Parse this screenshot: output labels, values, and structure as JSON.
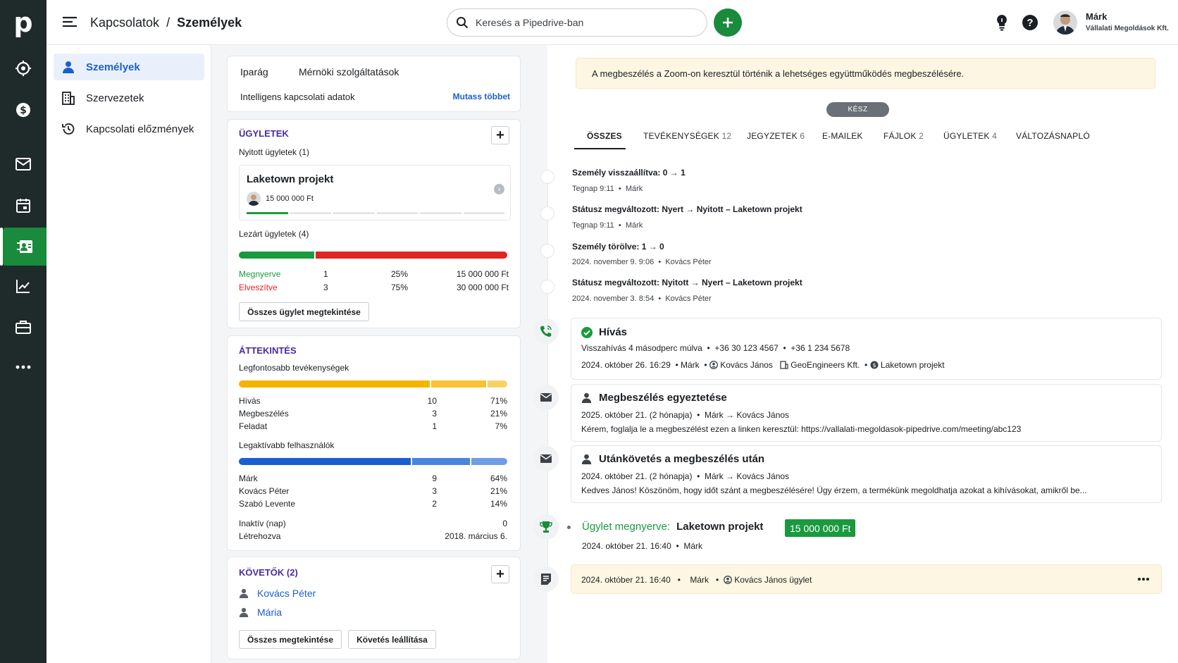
{
  "app": {
    "logo": "p"
  },
  "topbar": {
    "breadcrumb_parent": "Kapcsolatok",
    "breadcrumb_sep": "/",
    "breadcrumb_current": "Személyek",
    "search_placeholder": "Keresés a Pipedrive-ban",
    "user_name": "Márk",
    "user_company": "Vállalati Megoldások Kft."
  },
  "subnav": {
    "items": [
      {
        "label": "Személyek"
      },
      {
        "label": "Szervezetek"
      },
      {
        "label": "Kapcsolati előzmények"
      }
    ]
  },
  "info": {
    "industry_label": "Iparág",
    "industry_value": "Mérnöki szolgáltatások",
    "smart_label": "Intelligens kapcsolati adatok",
    "show_more": "Mutass többet"
  },
  "deals": {
    "title": "ÜGYLETEK",
    "open_label": "Nyitott ügyletek (1)",
    "deal_name": "Laketown projekt",
    "deal_value": "15 000 000 Ft",
    "closed_label": "Lezárt ügyletek (4)",
    "won_fraction": 0.28,
    "stats": [
      {
        "label": "Megnyerve",
        "count": "1",
        "pct": "25%",
        "amount": "15 000 000 Ft",
        "color": "#1a9a3e"
      },
      {
        "label": "Elveszítve",
        "count": "3",
        "pct": "75%",
        "amount": "30 000 000 Ft",
        "color": "#e02424"
      }
    ],
    "view_all": "Összes ügylet megtekintése"
  },
  "overview": {
    "title": "ÁTTEKINTÉS",
    "top_label": "Legfontosabb tevékenységek",
    "activities": [
      {
        "label": "Hívás",
        "count": "10",
        "pct": "71%",
        "share": 0.71
      },
      {
        "label": "Megbeszélés",
        "count": "3",
        "pct": "21%",
        "share": 0.21
      },
      {
        "label": "Feladat",
        "count": "1",
        "pct": "7%",
        "share": 0.08
      }
    ],
    "users_label": "Legaktívabb felhasználók",
    "users": [
      {
        "label": "Márk",
        "count": "9",
        "pct": "64%",
        "share": 0.64
      },
      {
        "label": "Kovács Péter",
        "count": "3",
        "pct": "21%",
        "share": 0.22
      },
      {
        "label": "Szabó Levente",
        "count": "2",
        "pct": "14%",
        "share": 0.14
      }
    ],
    "inactive_label": "Inaktív (nap)",
    "inactive_value": "0",
    "created_label": "Létrehozva",
    "created_value": "2018. március 6."
  },
  "followers": {
    "title": "KÖVETŐK (2)",
    "items": [
      {
        "name": "Kovács Péter"
      },
      {
        "name": "Mária"
      }
    ],
    "view_all": "Összes megtekintése",
    "stop": "Követés leállítása"
  },
  "banner": {
    "text": "A megbeszélés a Zoom-on keresztül történik a lehetséges együttműködés megbeszélésére.",
    "done": "KÉSZ"
  },
  "tabs": [
    {
      "label": "ÖSSZES",
      "count": ""
    },
    {
      "label": "TEVÉKENYSÉGEK",
      "count": "12"
    },
    {
      "label": "JEGYZETEK",
      "count": "6"
    },
    {
      "label": "E-MAILEK",
      "count": ""
    },
    {
      "label": "FÁJLOK",
      "count": "2"
    },
    {
      "label": "ÜGYLETEK",
      "count": "4"
    },
    {
      "label": "VÁLTOZÁSNAPLÓ",
      "count": ""
    }
  ],
  "changes": [
    {
      "title": "Személy visszaállítva: 0 → 1",
      "meta": "Tegnap 9:11",
      "user": "Márk"
    },
    {
      "title": "Státusz megváltozott: Nyert → Nyitott – Laketown projekt",
      "meta": "Tegnap 9:11",
      "user": "Márk"
    },
    {
      "title": "Személy törölve: 1 → 0",
      "meta": "2024. november 9. 9:06",
      "user": "Kovács Péter"
    },
    {
      "title": "Státusz megváltozott: Nyitott → Nyert – Laketown projekt",
      "meta": "2024. november 3. 8:54",
      "user": "Kovács Péter"
    }
  ],
  "call": {
    "title": "Hívás",
    "line1a": "Visszahívás 4 másodperc múlva",
    "phone1": "+36 30 123 4567",
    "phone2": "+36 1 234 5678",
    "date": "2024. október 26. 16:29",
    "user": "Márk",
    "person": "Kovács János",
    "org": "GeoEngineers Kft.",
    "deal": "Laketown projekt"
  },
  "email1": {
    "title": "Megbeszélés egyeztetése",
    "date": "2025. október 21. (2 hónapja)",
    "from": "Márk",
    "to": "Kovács János",
    "body": "Kérem, foglalja le a megbeszélést ezen a linken keresztül: https://vallalati-megoldasok-pipedrive.com/meeting/abc123"
  },
  "email2": {
    "title": "Utánkövetés a megbeszélés után",
    "date": "2024. október 21. (2 hónapja)",
    "from": "Márk",
    "to": "Kovács János",
    "body": "Kedves János! Köszönöm, hogy időt szánt a megbeszélésére! Úgy érzem, a termékünk megoldhatja azokat a kihívásokat, amikről be..."
  },
  "won": {
    "label": "Ügylet megnyerve:",
    "deal": "Laketown projekt",
    "amount": "15 000 000 Ft",
    "date": "2024. október 21. 16:40",
    "user": "Márk"
  },
  "note": {
    "date": "2024. október 21. 16:40",
    "user": "Márk",
    "person": "Kovács János ügylet"
  },
  "colors": {
    "rail": "#1f2b2a",
    "green": "#1a8a3c",
    "won": "#1a9a3e",
    "lost": "#e02424",
    "accent": "#1a5fd0",
    "section": "#4b2aa5"
  }
}
